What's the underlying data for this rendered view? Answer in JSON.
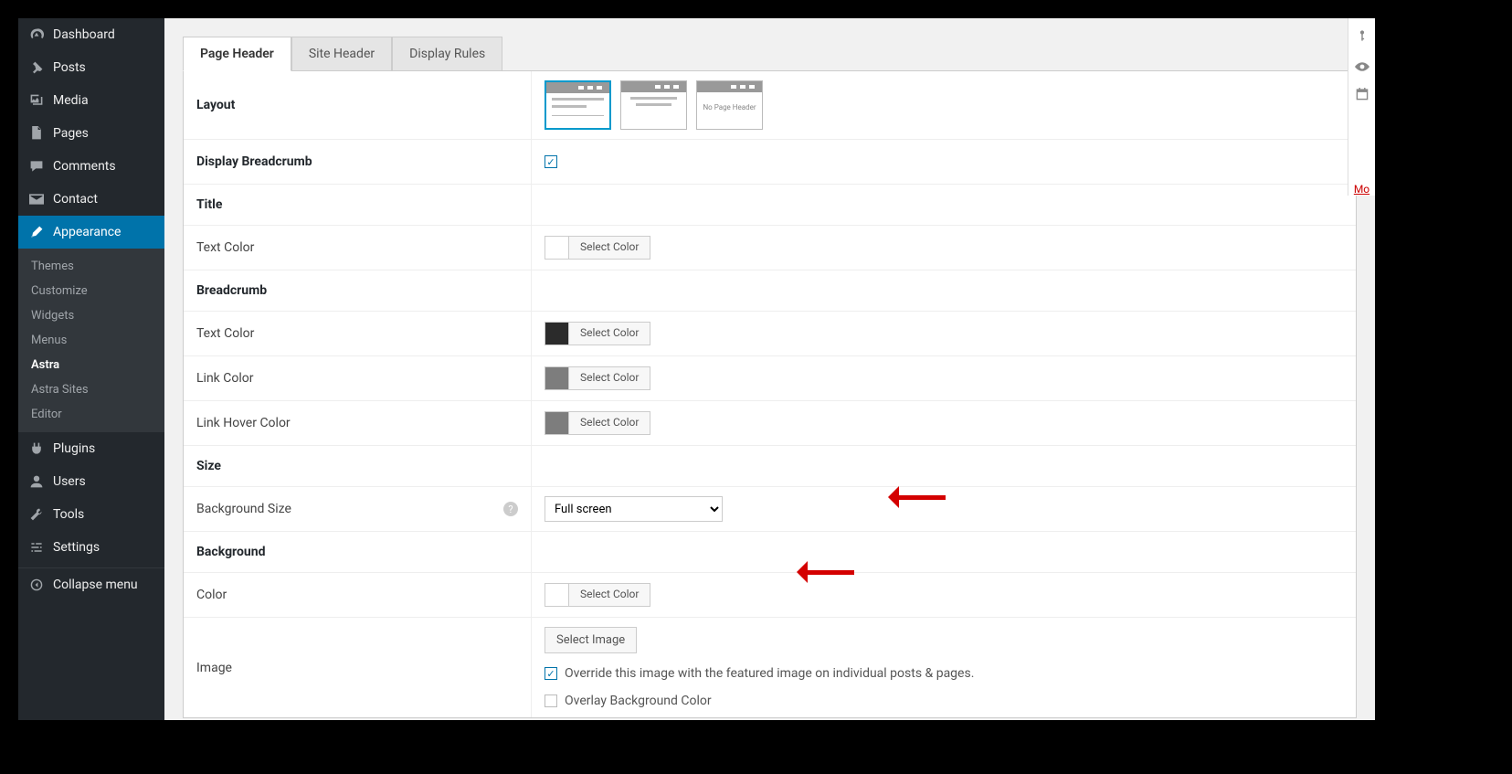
{
  "sidebar": {
    "dashboard": "Dashboard",
    "posts": "Posts",
    "media": "Media",
    "pages": "Pages",
    "comments": "Comments",
    "contact": "Contact",
    "appearance": "Appearance",
    "appearance_sub": {
      "themes": "Themes",
      "customize": "Customize",
      "widgets": "Widgets",
      "menus": "Menus",
      "astra": "Astra",
      "astra_sites": "Astra Sites",
      "editor": "Editor"
    },
    "plugins": "Plugins",
    "users": "Users",
    "tools": "Tools",
    "settings": "Settings",
    "collapse": "Collapse menu"
  },
  "tabs": {
    "page_header": "Page Header",
    "site_header": "Site Header",
    "display_rules": "Display Rules"
  },
  "rows": {
    "layout": "Layout",
    "layout_none": "No Page Header",
    "display_breadcrumb": "Display Breadcrumb",
    "title_section": "Title",
    "title_text_color": "Text Color",
    "breadcrumb_section": "Breadcrumb",
    "bc_text_color": "Text Color",
    "bc_link_color": "Link Color",
    "bc_link_hover": "Link Hover Color",
    "size_section": "Size",
    "bg_size": "Background Size",
    "bg_size_value": "Full screen",
    "background_section": "Background",
    "bg_color": "Color",
    "image": "Image",
    "select_image": "Select Image",
    "override": "Override this image with the featured image on individual posts & pages.",
    "overlay": "Overlay Background Color",
    "select_color": "Select Color"
  },
  "right": {
    "more": "Mo"
  }
}
